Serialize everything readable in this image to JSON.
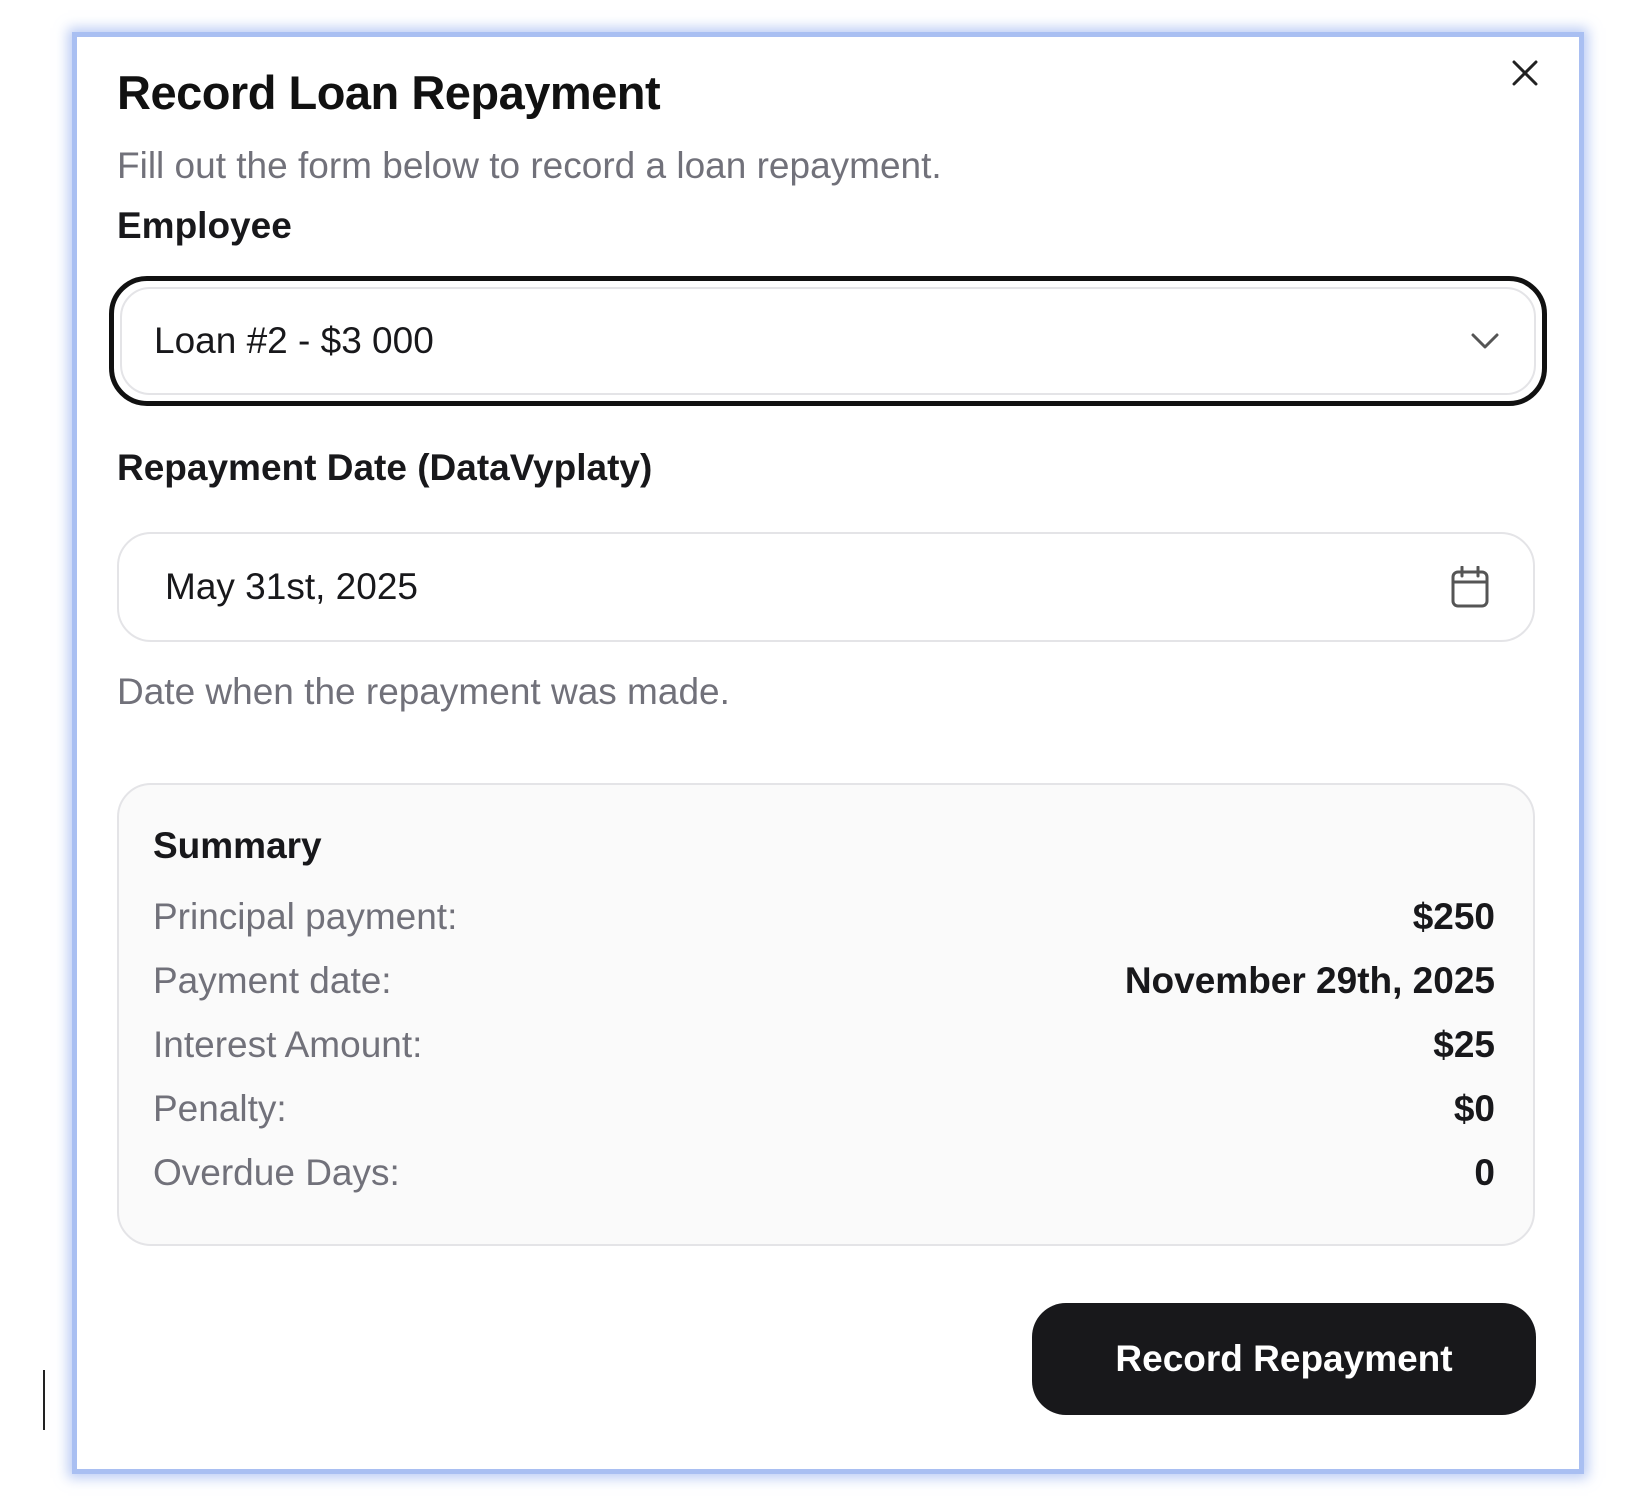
{
  "dialog": {
    "title": "Record Loan Repayment",
    "description": "Fill out the form below to record a loan repayment.",
    "close_icon": "close-icon"
  },
  "employee": {
    "label": "Employee",
    "selected_value": "Loan #2 - $3 000",
    "icon": "chevron-down-icon"
  },
  "repayment_date": {
    "label": "Repayment Date (DataVyplaty)",
    "value": "May 31st, 2025",
    "icon": "calendar-icon",
    "helper": "Date when the repayment was made."
  },
  "summary": {
    "title": "Summary",
    "rows": [
      {
        "label": "Principal payment:",
        "value": "$250"
      },
      {
        "label": "Payment date:",
        "value": "November 29th, 2025"
      },
      {
        "label": "Interest Amount:",
        "value": "$25"
      },
      {
        "label": "Penalty:",
        "value": "$0"
      },
      {
        "label": "Overdue Days:",
        "value": "0"
      }
    ]
  },
  "actions": {
    "submit_label": "Record Repayment"
  },
  "colors": {
    "dialog_border": "#a9bff2",
    "button_bg": "#18181b",
    "muted_text": "#71717a",
    "summary_bg": "#fafafa"
  }
}
